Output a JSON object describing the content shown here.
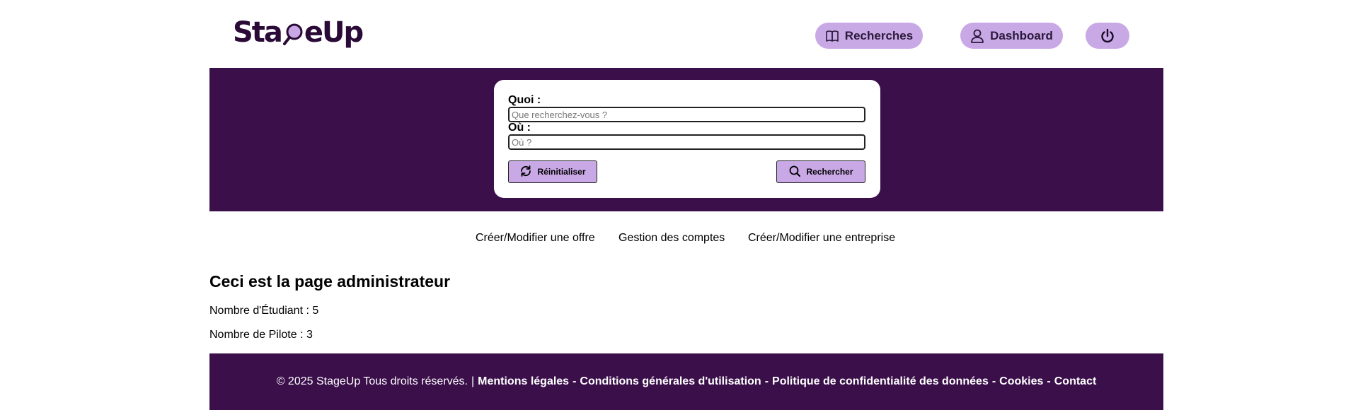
{
  "brand": {
    "name": "StageUp",
    "color": "#2a0a36",
    "accent": "#c9a8e6",
    "dark": "#3a0f4a"
  },
  "nav": {
    "recherches_label": "Recherches",
    "dashboard_label": "Dashboard"
  },
  "search": {
    "quoi_label": "Quoi :",
    "quoi_placeholder": "Que recherchez-vous ?",
    "ou_label": "Où :",
    "ou_placeholder": "Où ?",
    "reset_label": "Réinitialiser",
    "search_label": "Rechercher"
  },
  "subnav": {
    "items": [
      "Créer/Modifier une offre",
      "Gestion des comptes",
      "Créer/Modifier une entreprise"
    ]
  },
  "main": {
    "title": "Ceci est la page administrateur",
    "students": "Nombre d'Étudiant : 5",
    "pilots": "Nombre de Pilote : 3"
  },
  "footer": {
    "copyright": "© 2025 StageUp Tous droits réservés.",
    "separator": "|",
    "links": [
      "Mentions légales",
      "Conditions générales d'utilisation",
      "Politique de confidentialité des données",
      "Cookies",
      "Contact"
    ]
  }
}
